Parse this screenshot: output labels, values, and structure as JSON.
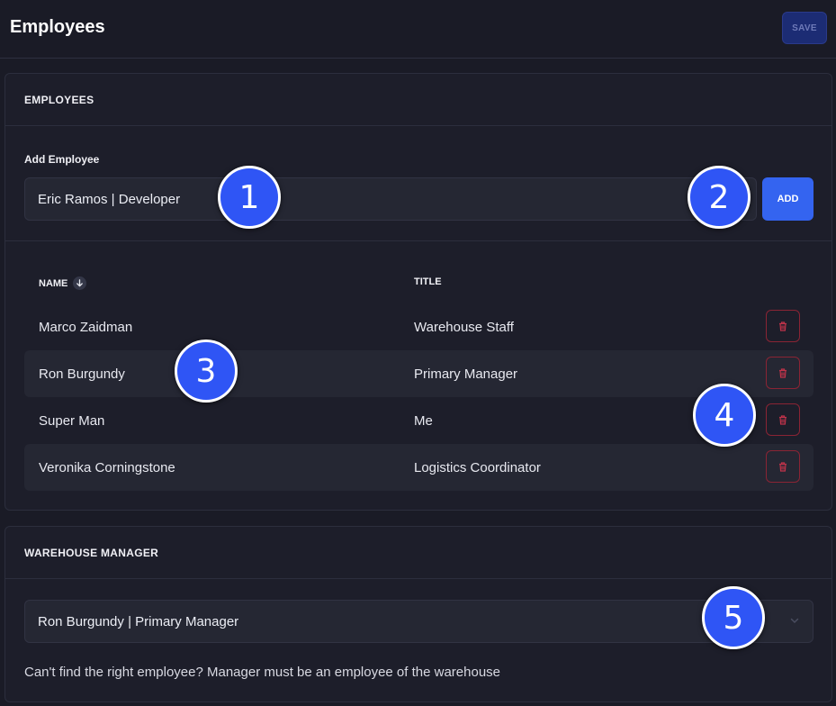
{
  "header": {
    "title": "Employees",
    "save_label": "SAVE"
  },
  "employees_card": {
    "title": "EMPLOYEES",
    "add_label": "Add Employee",
    "add_input_value": "Eric Ramos | Developer",
    "add_button_label": "ADD",
    "columns": {
      "name": "NAME",
      "title": "TITLE"
    },
    "rows": [
      {
        "name": "Marco Zaidman",
        "title": "Warehouse Staff"
      },
      {
        "name": "Ron Burgundy",
        "title": "Primary Manager"
      },
      {
        "name": "Super Man",
        "title": "Me"
      },
      {
        "name": "Veronika Corningstone",
        "title": "Logistics Coordinator"
      }
    ]
  },
  "manager_card": {
    "title": "WAREHOUSE MANAGER",
    "selected_value": "Ron Burgundy | Primary Manager",
    "helper_text": "Can't find the right employee? Manager must be an employee of the warehouse"
  },
  "badges": [
    "1",
    "2",
    "3",
    "4",
    "5"
  ],
  "icons": {
    "sort": "arrow-down-icon",
    "delete": "trash-icon",
    "select": "chevron-down-icon"
  },
  "colors": {
    "accent": "#3464f0",
    "danger": "#c0334a",
    "background": "#1a1b26",
    "badge": "#2f55f5"
  }
}
